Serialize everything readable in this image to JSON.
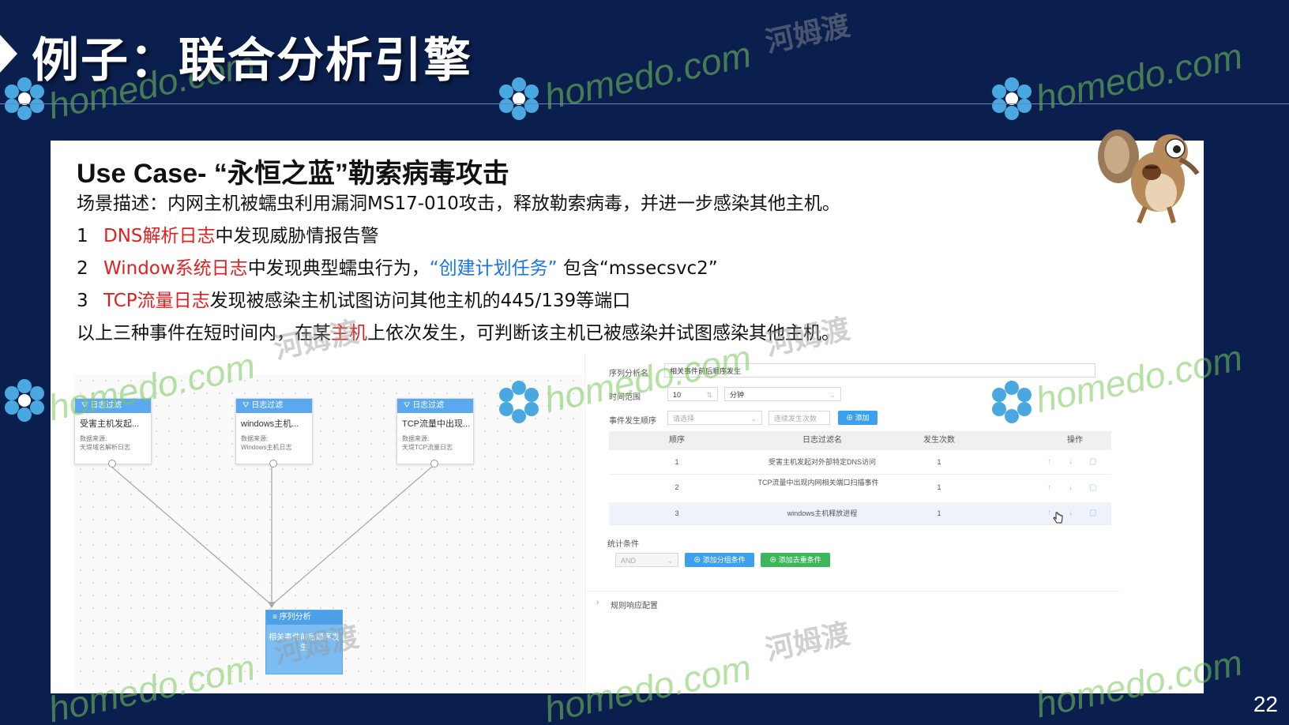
{
  "slide": {
    "title": "例子：联合分析引擎",
    "page_number": "22"
  },
  "content": {
    "use_case_title": "Use Case- “永恒之蓝”勒索病毒攻击",
    "scene": "场景描述：内网主机被蠕虫利用漏洞MS17-010攻击，释放勒索病毒，并进一步感染其他主机。",
    "items": [
      {
        "num": "1",
        "highlight": "DNS解析日志",
        "rest": "中发现威胁情报告警"
      },
      {
        "num": "2",
        "highlight": "Window系统日志",
        "rest": "中发现典型蠕虫行为，",
        "quote1": "“创建计划任务”",
        "rest2": " 包含“mssecsvc2”"
      },
      {
        "num": "3",
        "highlight": "TCP流量日志",
        "rest": "发现被感染主机试图访问其他主机的445/139等端口"
      }
    ],
    "conclusion_pre": "以上三种事件在短时间内，在某",
    "conclusion_hl": "主机",
    "conclusion_post": "上依次发生，可判断该主机已被感染并试图感染其他主机。"
  },
  "graph": {
    "nodes": [
      {
        "head": "日志过滤",
        "name": "受害主机发起...",
        "src_label": "数据来源:",
        "src": "天堤域名解析日志"
      },
      {
        "head": "日志过滤",
        "name": "windows主机...",
        "src_label": "数据来源:",
        "src": "Windows主机日志"
      },
      {
        "head": "日志过滤",
        "name": "TCP流量中出现...",
        "src_label": "数据来源:",
        "src": "天堤TCP流量日志"
      }
    ],
    "seq_node": {
      "head": "序列分析",
      "text": "相关事件前后顺序发生"
    }
  },
  "panel": {
    "seq_name_label": "序列分析名",
    "seq_name_value": "相关事件前后顺序发生",
    "time_range_label": "时间范围",
    "time_value": "10",
    "time_unit": "分钟",
    "order_label": "事件发生顺序",
    "order_select_placeholder": "请选择",
    "order_count_placeholder": "连续发生次数",
    "add_button": "⊕ 添加",
    "table_headers": [
      "顺序",
      "日志过滤名",
      "发生次数",
      "操作"
    ],
    "rows": [
      {
        "order": "1",
        "name": "受害主机发起对外部特定DNS访问",
        "count": "1"
      },
      {
        "order": "2",
        "name": "TCP流量中出现内网相关端口扫描事件",
        "count": "1"
      },
      {
        "order": "3",
        "name": "windows主机释放进程",
        "count": "1"
      }
    ],
    "stat_label": "统计条件",
    "logic_value": "AND",
    "add_group_button": "⊕ 添加分组条件",
    "add_dedup_button": "⊕ 添加去重条件",
    "rule_response": "规则响应配置"
  },
  "watermark": {
    "brand": "homedo.com",
    "cn": "河姆渡"
  }
}
